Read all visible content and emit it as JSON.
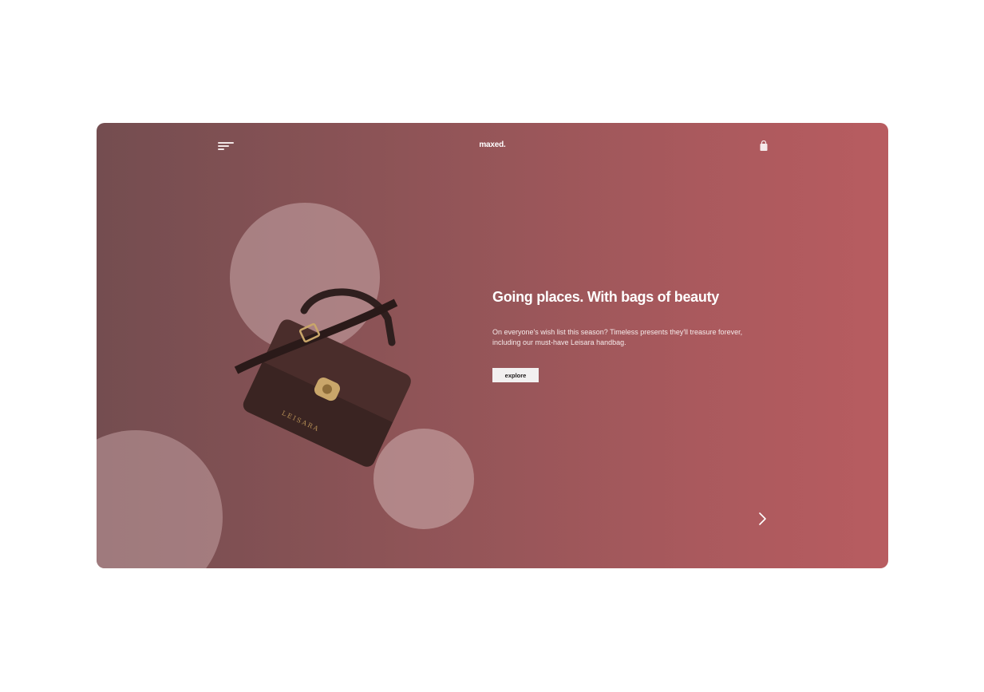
{
  "header": {
    "brand": "maxed."
  },
  "hero": {
    "headline": "Going places. With bags of beauty",
    "description": "On everyone's wish list this season? Timeless presents they'll treasure forever, including our must-have Leisara handbag.",
    "cta_label": "explore",
    "product_brand": "LEISARA"
  },
  "icons": {
    "menu": "menu-icon",
    "cart": "shopping-bag-icon",
    "next": "chevron-right-icon"
  },
  "colors": {
    "gradient_start": "#744d50",
    "gradient_end": "#b85c60",
    "circle": "#c9a8a9",
    "button_bg": "#f2f0f0"
  }
}
